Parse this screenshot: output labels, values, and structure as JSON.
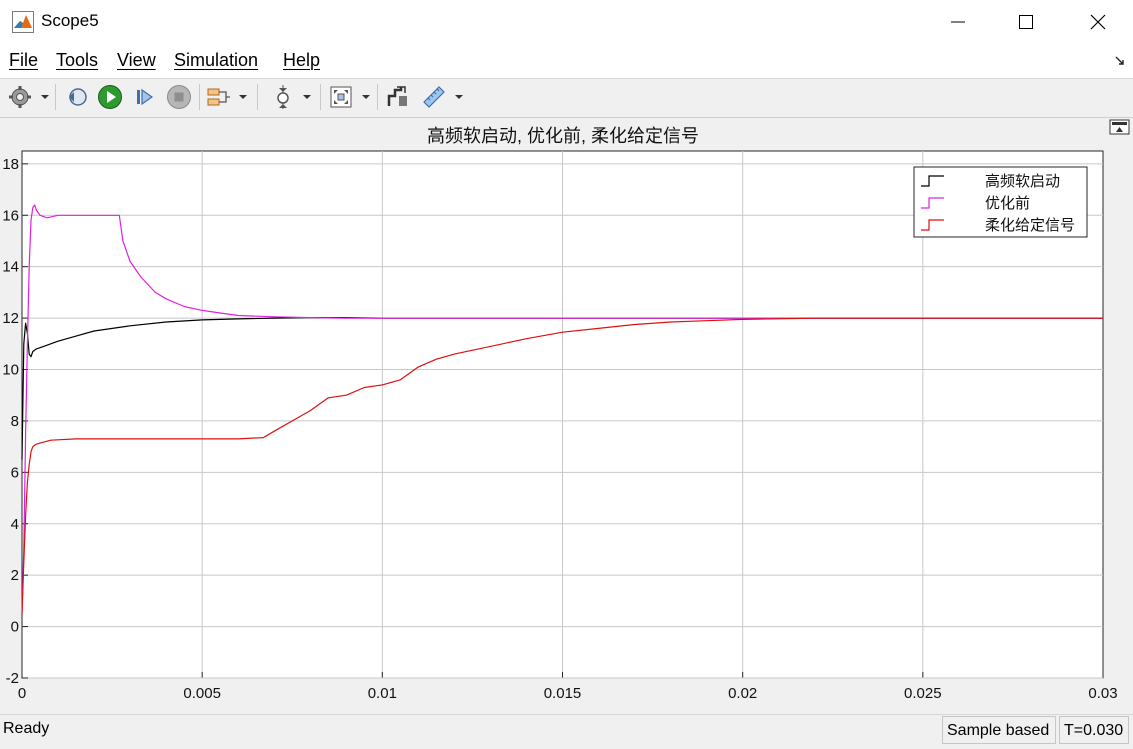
{
  "window": {
    "title": "Scope5"
  },
  "menu": {
    "file": "File",
    "tools": "Tools",
    "view": "View",
    "simulation": "Simulation",
    "help": "Help"
  },
  "toolbar": {
    "icons": [
      "gear-icon",
      "restore-icon",
      "run-icon",
      "step-forward-icon",
      "stop-icon",
      "signal-block-icon",
      "zoom-icon",
      "fit-to-view-icon",
      "cursor-measure-icon",
      "measure-icon"
    ]
  },
  "status": {
    "ready": "Ready",
    "mode": "Sample based",
    "time": "T=0.030"
  },
  "colors": {
    "black_series": "#000000",
    "magenta_series": "#e020e0",
    "red_series": "#dd1010",
    "grid": "#c8c8c8",
    "axes_bg": "#ffffff"
  },
  "chart_data": {
    "type": "line",
    "title": "高频软启动, 优化前, 柔化给定信号",
    "xlabel": "",
    "ylabel": "",
    "xlim": [
      0,
      0.03
    ],
    "ylim": [
      -2,
      18.5
    ],
    "xticks": [
      "0",
      "0.005",
      "0.01",
      "0.015",
      "0.02",
      "0.025",
      "0.03"
    ],
    "yticks": [
      "-2",
      "0",
      "2",
      "4",
      "6",
      "8",
      "10",
      "12",
      "14",
      "16",
      "18"
    ],
    "grid": true,
    "legend_position": "top-right",
    "series": [
      {
        "name": "高频软启动",
        "color": "#000000",
        "x": [
          0,
          5e-05,
          0.0001,
          0.00015,
          0.0002,
          0.00025,
          0.0003,
          0.0004,
          0.0006,
          0.001,
          0.0015,
          0.002,
          0.003,
          0.004,
          0.005,
          0.006,
          0.007,
          0.008,
          0.009,
          0.01,
          0.015,
          0.02,
          0.025,
          0.03
        ],
        "y": [
          6.5,
          11.0,
          11.8,
          11.4,
          10.6,
          10.5,
          10.7,
          10.8,
          10.9,
          11.1,
          11.3,
          11.5,
          11.7,
          11.85,
          11.93,
          11.97,
          12.0,
          12.02,
          12.02,
          12.0,
          12.0,
          12.0,
          12.0,
          12.0
        ]
      },
      {
        "name": "优化前",
        "color": "#e020e0",
        "x": [
          0,
          5e-05,
          0.0001,
          0.00015,
          0.0002,
          0.00025,
          0.0003,
          0.00035,
          0.0004,
          0.0005,
          0.0007,
          0.001,
          0.0015,
          0.002,
          0.0025,
          0.0027,
          0.0028,
          0.003,
          0.0033,
          0.0037,
          0.004,
          0.0045,
          0.005,
          0.0055,
          0.006,
          0.007,
          0.008,
          0.009,
          0.01,
          0.015,
          0.02,
          0.025,
          0.03
        ],
        "y": [
          0.5,
          3.0,
          7.5,
          11.0,
          14.0,
          15.8,
          16.3,
          16.4,
          16.2,
          16.0,
          15.9,
          16.0,
          16.0,
          16.0,
          16.0,
          16.0,
          15.0,
          14.2,
          13.6,
          13.0,
          12.75,
          12.45,
          12.3,
          12.2,
          12.1,
          12.05,
          12.02,
          12.0,
          12.0,
          12.0,
          12.0,
          12.0,
          12.0
        ]
      },
      {
        "name": "柔化给定信号",
        "color": "#dd1010",
        "x": [
          0,
          5e-05,
          0.0001,
          0.00015,
          0.0002,
          0.00025,
          0.0003,
          0.0004,
          0.0008,
          0.0015,
          0.002,
          0.003,
          0.004,
          0.005,
          0.006,
          0.0067,
          0.007,
          0.0075,
          0.008,
          0.0085,
          0.009,
          0.0095,
          0.01,
          0.0105,
          0.011,
          0.0115,
          0.012,
          0.013,
          0.014,
          0.015,
          0.016,
          0.017,
          0.018,
          0.019,
          0.02,
          0.022,
          0.025,
          0.03
        ],
        "y": [
          0.5,
          2.5,
          4.3,
          5.6,
          6.3,
          6.8,
          7.0,
          7.1,
          7.25,
          7.3,
          7.3,
          7.3,
          7.3,
          7.3,
          7.3,
          7.35,
          7.6,
          8.0,
          8.4,
          8.9,
          9.0,
          9.3,
          9.4,
          9.6,
          10.1,
          10.4,
          10.6,
          10.9,
          11.2,
          11.45,
          11.6,
          11.75,
          11.85,
          11.9,
          11.95,
          12.0,
          12.0,
          12.0
        ]
      }
    ]
  }
}
